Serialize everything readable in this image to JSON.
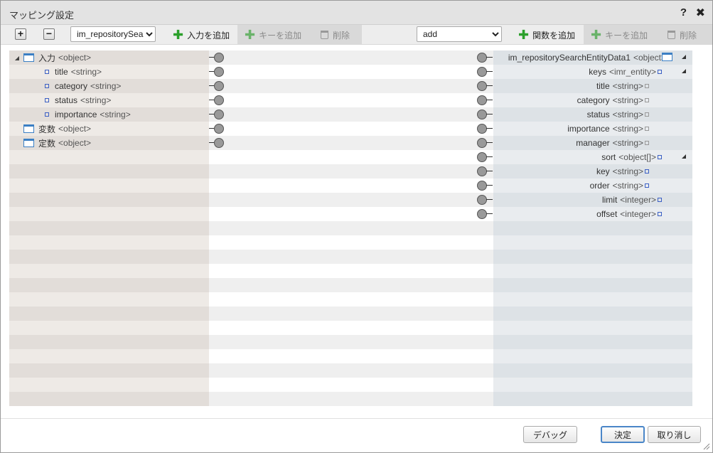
{
  "dialog": {
    "title": "マッピング設定",
    "help": "?",
    "close": "✖"
  },
  "toolbar": {
    "expand_label": "+",
    "collapse_label": "−",
    "source_select": {
      "value": "im_repositorySea",
      "options": [
        "im_repositorySea"
      ]
    },
    "add_input_label": "入力を追加",
    "add_key_left_label": "キーを追加",
    "delete_left_label": "削除",
    "func_select": {
      "value": "add",
      "options": [
        "add"
      ]
    },
    "add_function_label": "関数を追加",
    "add_key_right_label": "キーを追加",
    "delete_right_label": "削除"
  },
  "source_tree": [
    {
      "name": "入力",
      "type": "<object>",
      "kind": "object",
      "indent": 0,
      "expanded": true
    },
    {
      "name": "title",
      "type": "<string>",
      "kind": "leaf",
      "indent": 1
    },
    {
      "name": "category",
      "type": "<string>",
      "kind": "leaf",
      "indent": 1
    },
    {
      "name": "status",
      "type": "<string>",
      "kind": "leaf",
      "indent": 1
    },
    {
      "name": "importance",
      "type": "<string>",
      "kind": "leaf",
      "indent": 1
    },
    {
      "name": "変数",
      "type": "<object>",
      "kind": "object",
      "indent": 0
    },
    {
      "name": "定数",
      "type": "<object>",
      "kind": "object",
      "indent": 0
    }
  ],
  "target_tree": [
    {
      "name": "im_repositorySearchEntityData1",
      "type": "<object>",
      "kind": "object",
      "level": 0,
      "expandable": true
    },
    {
      "name": "keys",
      "type": "<imr_entity>",
      "kind": "blue",
      "level": 1,
      "expandable": true
    },
    {
      "name": "title",
      "type": "<string>",
      "kind": "grey",
      "level": 2
    },
    {
      "name": "category",
      "type": "<string>",
      "kind": "grey",
      "level": 2
    },
    {
      "name": "status",
      "type": "<string>",
      "kind": "grey",
      "level": 2
    },
    {
      "name": "importance",
      "type": "<string>",
      "kind": "grey",
      "level": 2
    },
    {
      "name": "manager",
      "type": "<string>",
      "kind": "grey",
      "level": 2
    },
    {
      "name": "sort",
      "type": "<object[]>",
      "kind": "blue",
      "level": 1,
      "expandable": true
    },
    {
      "name": "key",
      "type": "<string>",
      "kind": "blue",
      "level": 2
    },
    {
      "name": "order",
      "type": "<string>",
      "kind": "blue",
      "level": 2
    },
    {
      "name": "limit",
      "type": "<integer>",
      "kind": "blue",
      "level": 1
    },
    {
      "name": "offset",
      "type": "<integer>",
      "kind": "blue",
      "level": 1
    }
  ],
  "footer": {
    "debug_label": "デバッグ",
    "ok_label": "決定",
    "cancel_label": "取り消し"
  }
}
